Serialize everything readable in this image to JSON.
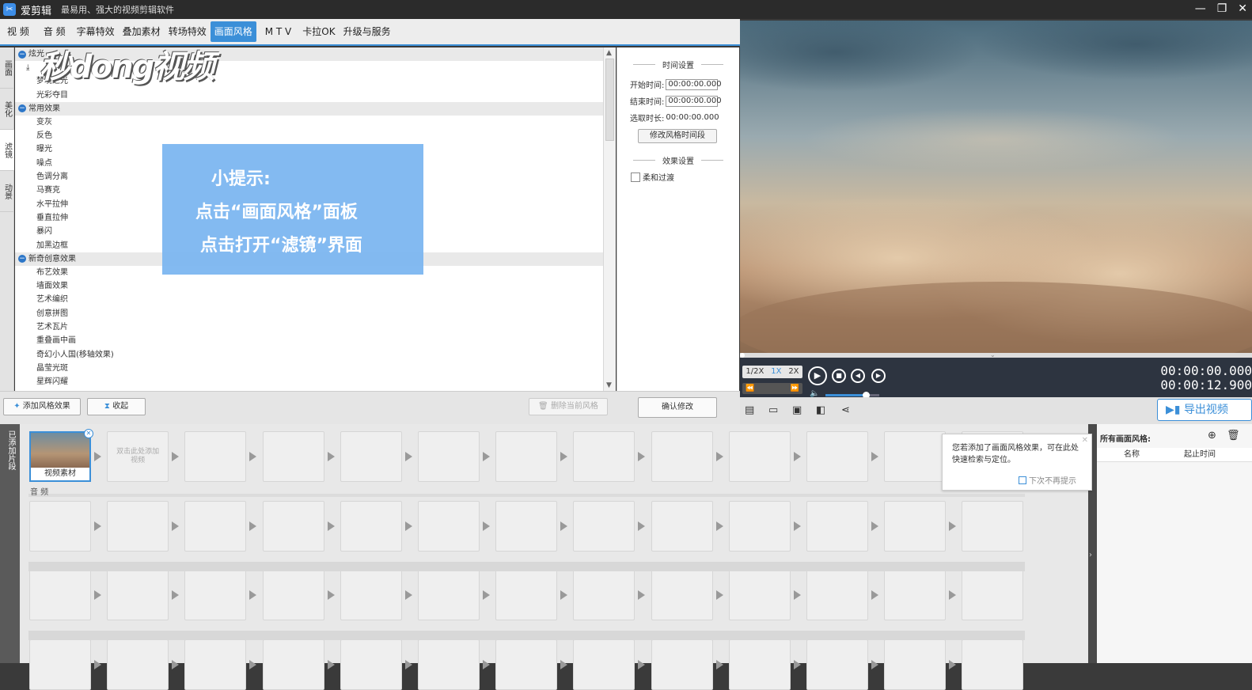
{
  "titlebar": {
    "app_name": "爱剪辑",
    "slogan": "最易用、强大的视频剪辑软件"
  },
  "menu": {
    "tabs": [
      {
        "label": "视 频"
      },
      {
        "label": "音 频"
      },
      {
        "label": "字幕特效"
      },
      {
        "label": "叠加素材"
      },
      {
        "label": "转场特效"
      },
      {
        "label": "画面风格"
      },
      {
        "label": "M T V"
      },
      {
        "label": "卡拉OK"
      },
      {
        "label": "升级与服务"
      }
    ],
    "active_tab": "画面风格"
  },
  "side_tabs": [
    {
      "label": "画面"
    },
    {
      "label": "美化"
    },
    {
      "label": "滤镜"
    },
    {
      "label": "动景"
    }
  ],
  "tree": {
    "groups": [
      {
        "name": "炫光",
        "items": [
          "梦境之光",
          "光彩夺目"
        ]
      },
      {
        "name": "常用效果",
        "items": [
          "变灰",
          "反色",
          "曝光",
          "噪点",
          "色调分离",
          "马赛克",
          "水平拉伸",
          "垂直拉伸",
          "暴闪",
          "加黑边框"
        ]
      },
      {
        "name": "新奇创意效果",
        "items": [
          "布艺效果",
          "墙面效果",
          "艺术编织",
          "创意拼图",
          "艺术瓦片",
          "重叠画中画",
          "奇幻小人国(移轴效果)",
          "晶莹光斑",
          "星辉闪耀"
        ]
      }
    ]
  },
  "settings": {
    "time_header": "时间设置",
    "start_label": "开始时间:",
    "start_value": "00:00:00.000",
    "end_label": "结束时间:",
    "end_value": "00:00:00.000",
    "duration_label": "选取时长:",
    "duration_value": "00:00:00.000",
    "modify_time_button": "修改风格时间段",
    "effect_header": "效果设置",
    "soft_transition_label": "柔和过渡",
    "confirm_button": "确认修改"
  },
  "bottom": {
    "add_effect_button": "添加风格效果",
    "collapse_button": "收起",
    "delete_button": "删除当前风格"
  },
  "hint": {
    "title": "小提示:",
    "line1": "点击“画面风格”面板",
    "line2": "点击打开“滤镜”界面"
  },
  "watermark": "秒dong视频",
  "player": {
    "speeds": [
      "1/2X",
      "1X",
      "2X"
    ],
    "active_speed": "1X",
    "current_time": "00:00:00.000",
    "total_time": "00:00:12.900",
    "volume": 0.75,
    "export_button": "导出视频"
  },
  "timeline": {
    "side_label": "已添加片段",
    "clip_label": "视频素材",
    "empty_slot_label": "双击此处添加视频",
    "audio_label": "音 频"
  },
  "tooltip": {
    "text": "您若添加了画面风格效果，可在此处快速检索与定位。",
    "checkbox_label": "下次不再提示"
  },
  "right_panel": {
    "title": "所有画面风格:",
    "col_name": "名称",
    "col_time": "起止时间"
  },
  "colors": {
    "accent": "#3b8fd8",
    "hint_bg": "#78b4f0",
    "titlebar": "#2b2b2b"
  }
}
